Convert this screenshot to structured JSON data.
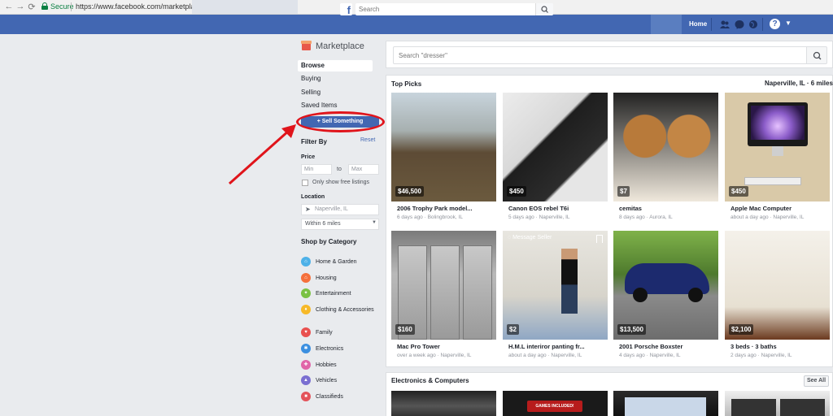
{
  "browser": {
    "secure_label": "Secure",
    "url": "https://www.facebook.com/marketplace/"
  },
  "fb_header": {
    "logo": "f",
    "search_placeholder": "Search",
    "home_label": "Home",
    "brand_color": "#4267b2"
  },
  "sidebar": {
    "title": "Marketplace",
    "nav": [
      {
        "label": "Browse",
        "active": true
      },
      {
        "label": "Buying"
      },
      {
        "label": "Selling"
      },
      {
        "label": "Saved Items"
      }
    ],
    "sell_button": "+ Sell Something",
    "filter_title": "Filter By",
    "reset_label": "Reset",
    "price_title": "Price",
    "min_placeholder": "Min",
    "to_label": "to",
    "max_placeholder": "Max",
    "free_label": "Only show free listings",
    "location_title": "Location",
    "location_value": "Naperville, IL",
    "within_value": "Within 6 miles",
    "category_title": "Shop by Category",
    "categories": [
      {
        "label": "Home & Garden",
        "color": "#4db1e8",
        "icon": "home-icon"
      },
      {
        "label": "Housing",
        "color": "#f5703c",
        "icon": "house-icon"
      },
      {
        "label": "Entertainment",
        "color": "#7ac142",
        "icon": "ticket-icon"
      },
      {
        "label": "Clothing & Accessories",
        "color": "#f7b928",
        "icon": "shirt-icon"
      },
      {
        "label": "Family",
        "color": "#e9504f",
        "icon": "heart-icon"
      },
      {
        "label": "Electronics",
        "color": "#3b8fe0",
        "icon": "bulb-icon"
      },
      {
        "label": "Hobbies",
        "color": "#e065a8",
        "icon": "puzzle-icon"
      },
      {
        "label": "Vehicles",
        "color": "#7a6fd1",
        "icon": "car-icon"
      },
      {
        "label": "Classifieds",
        "color": "#e3535a",
        "icon": "tag-icon"
      }
    ]
  },
  "search": {
    "placeholder": "Search \"dresser\""
  },
  "top_picks": {
    "title": "Top Picks",
    "location": "Naperville, IL · 6 miles",
    "message_seller": "Message Seller",
    "listings": [
      {
        "price": "$46,500",
        "title": "2006 Trophy Park model...",
        "meta": "6 days ago · Bolingbrook, IL"
      },
      {
        "price": "$450",
        "title": "Canon EOS rebel T6i",
        "meta": "5 days ago · Naperville, IL"
      },
      {
        "price": "$7",
        "title": "cemitas",
        "meta": "8 days ago · Aurora, IL"
      },
      {
        "price": "$450",
        "title": "Apple Mac Computer",
        "meta": "about a day ago · Naperville, IL"
      },
      {
        "price": "$160",
        "title": "Mac Pro Tower",
        "meta": "over a week ago · Naperville, IL"
      },
      {
        "price": "$2",
        "title": "H.M.L interiror panting fr...",
        "meta": "about a day ago · Naperville, IL"
      },
      {
        "price": "$13,500",
        "title": "2001 Porsche Boxster",
        "meta": "4 days ago · Naperville, IL"
      },
      {
        "price": "$2,100",
        "title": "3 beds · 3 baths",
        "meta": "2 days ago · Naperville, IL"
      }
    ]
  },
  "electronics": {
    "title": "Electronics & Computers",
    "see_all": "See All",
    "thumb_text": "GAMES INCLUDED!"
  }
}
